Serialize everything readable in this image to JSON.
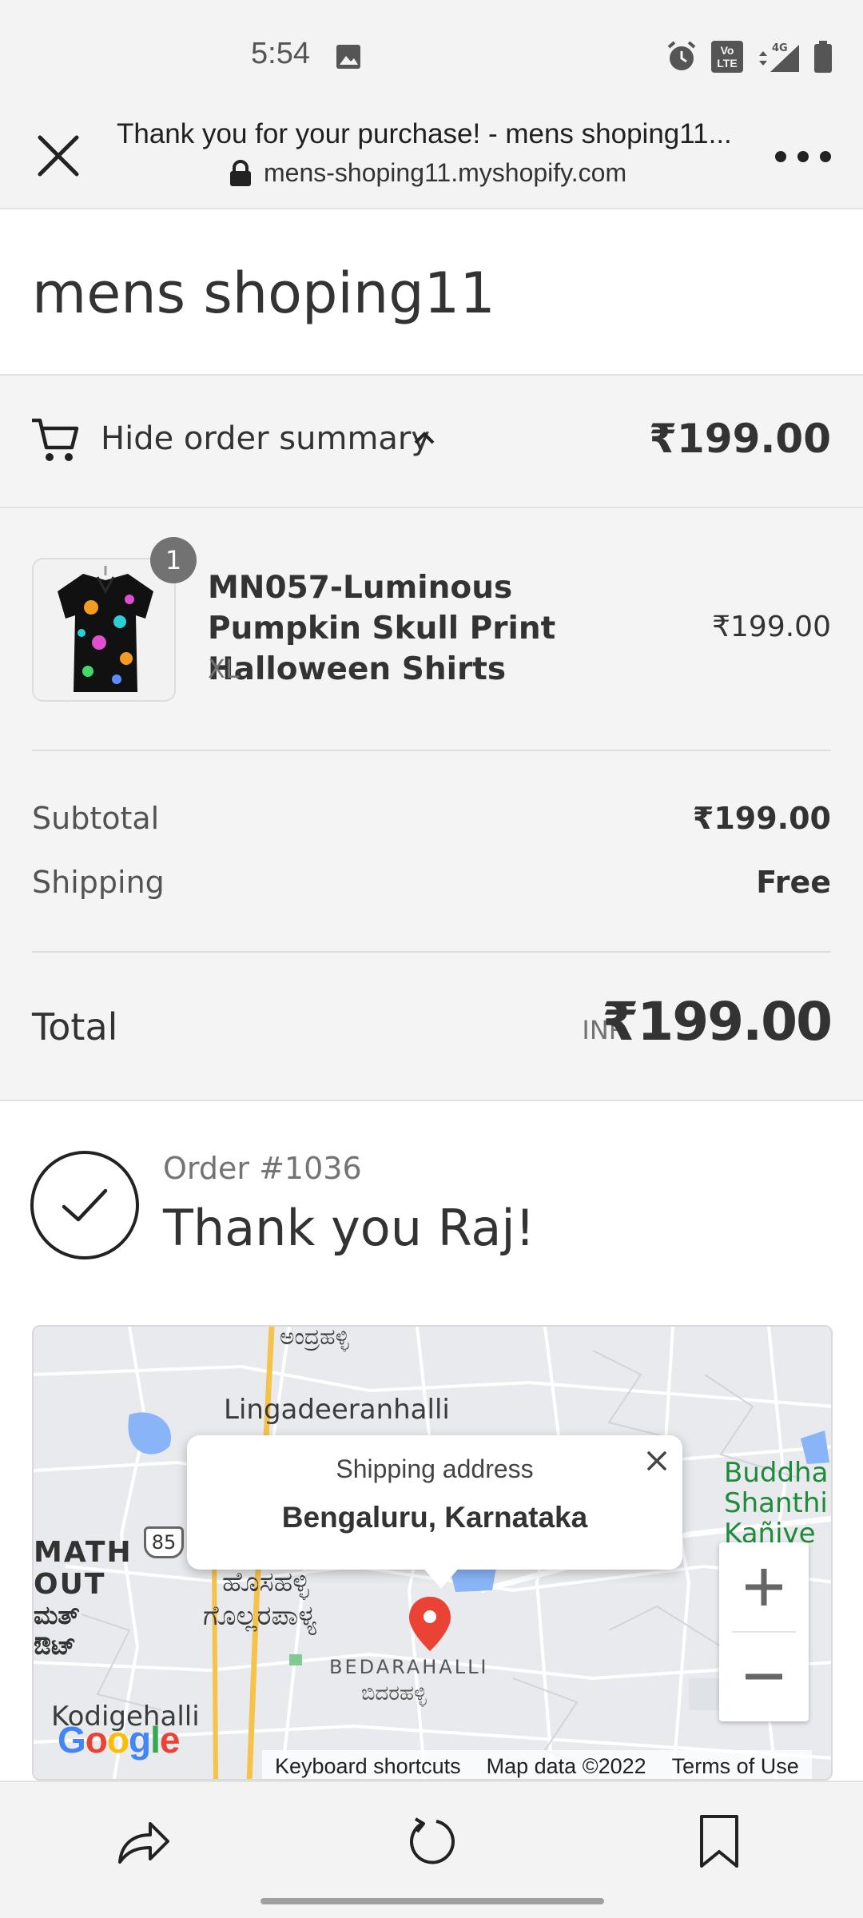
{
  "status_bar": {
    "time": "5:54",
    "network": "4G",
    "volte": "Vo LTE"
  },
  "browser": {
    "page_title": "Thank you for your purchase! - mens shoping11...",
    "url": "mens-shoping11.myshopify.com"
  },
  "store": {
    "name": "mens shoping11"
  },
  "summary_toggle": {
    "label": "Hide order summary",
    "total": "₹199.00"
  },
  "line_item": {
    "quantity": "1",
    "name": "MN057-Luminous Pumpkin Skull Print Halloween Shirts",
    "variant": "XL",
    "price": "₹199.00"
  },
  "totals": {
    "subtotal_label": "Subtotal",
    "subtotal_value": "₹199.00",
    "shipping_label": "Shipping",
    "shipping_value": "Free",
    "total_label": "Total",
    "currency": "INR",
    "total_value": "₹199.00"
  },
  "confirmation": {
    "order_number": "Order #1036",
    "thank_you": "Thank you Raj!"
  },
  "map": {
    "labels": {
      "top": "ಅಂದ್ರಹಳ್ಳಿ",
      "lingadeeranhalli": "Lingadeeranhalli",
      "math": "MATH",
      "out": "OUT",
      "kannada_math": "ಮತ್",
      "kannada_out": "ಔಟ್",
      "road_number": "85",
      "hosahalli_kn": "ಹೊಸಹಳ್ಳಿ",
      "gollarapalya_kn": "ಗೊಲ್ಲರಪಾಳ್ಯ",
      "bedarahalli": "BEDARAHALLI",
      "bedarahalli_kn": "ಬಿದರಹಳ್ಳಿ",
      "kodigehalli": "Kodigehalli",
      "buddha_1": "Buddha",
      "buddha_2": "Shanthi",
      "buddha_3": "Kañive"
    },
    "popup_title": "Shipping address",
    "popup_value": "Bengaluru, Karnataka",
    "google": "Google",
    "footer": {
      "shortcuts": "Keyboard shortcuts",
      "map_data": "Map data ©2022",
      "terms": "Terms of Use"
    }
  }
}
